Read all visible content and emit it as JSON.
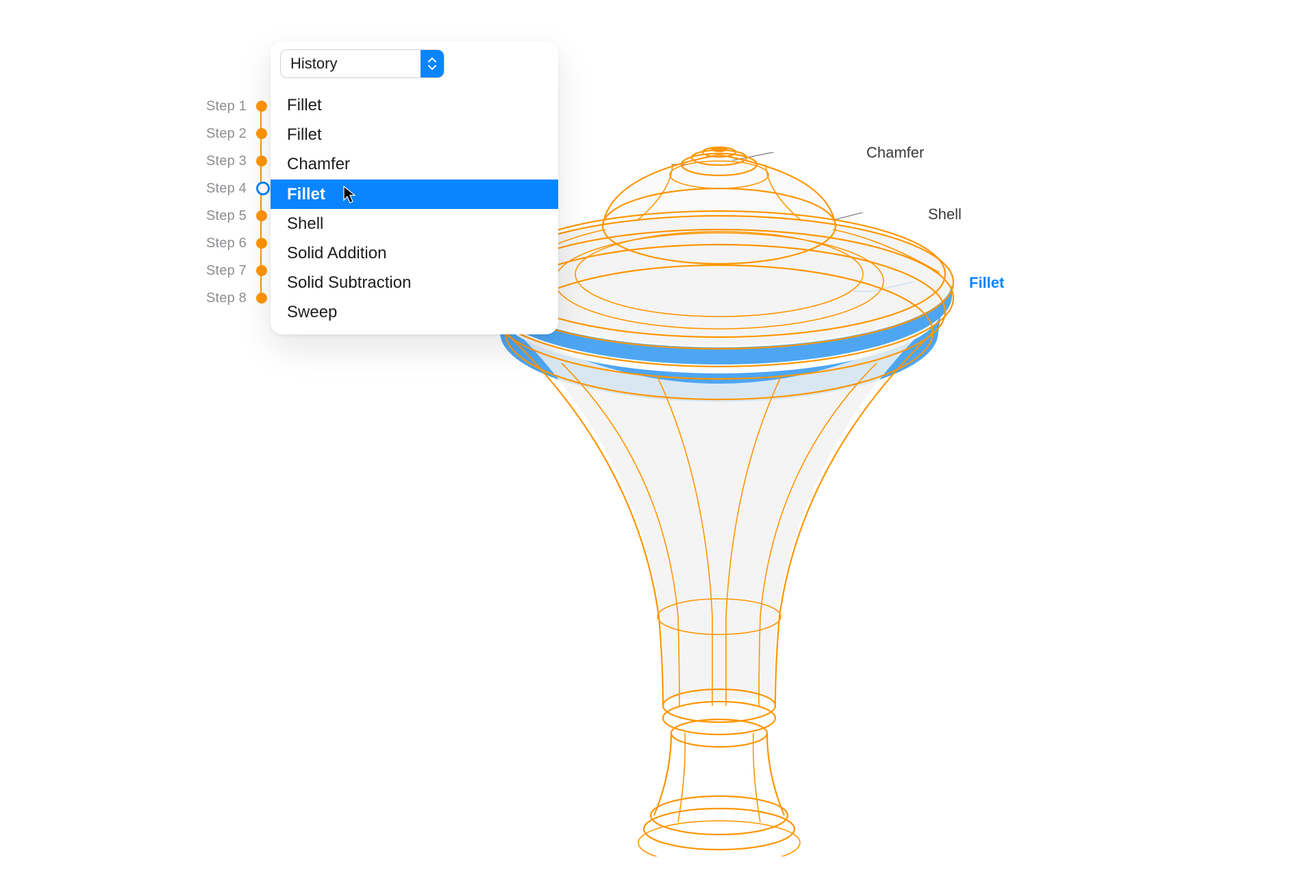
{
  "panel": {
    "select_label": "History",
    "items": [
      {
        "label": "Fillet",
        "selected": false
      },
      {
        "label": "Fillet",
        "selected": false
      },
      {
        "label": "Chamfer",
        "selected": false
      },
      {
        "label": "Fillet",
        "selected": true
      },
      {
        "label": "Shell",
        "selected": false
      },
      {
        "label": "Solid Addition",
        "selected": false
      },
      {
        "label": "Solid Subtraction",
        "selected": false
      },
      {
        "label": "Sweep",
        "selected": false
      }
    ]
  },
  "timeline": {
    "steps": [
      {
        "label": "Step 1",
        "state": "done"
      },
      {
        "label": "Step 2",
        "state": "done"
      },
      {
        "label": "Step 3",
        "state": "done"
      },
      {
        "label": "Step 4",
        "state": "current"
      },
      {
        "label": "Step 5",
        "state": "future"
      },
      {
        "label": "Step 6",
        "state": "future"
      },
      {
        "label": "Step 7",
        "state": "future"
      },
      {
        "label": "Step 8",
        "state": "future"
      }
    ]
  },
  "callouts": {
    "chamfer": "Chamfer",
    "shell": "Shell",
    "fillet": "Fillet"
  }
}
